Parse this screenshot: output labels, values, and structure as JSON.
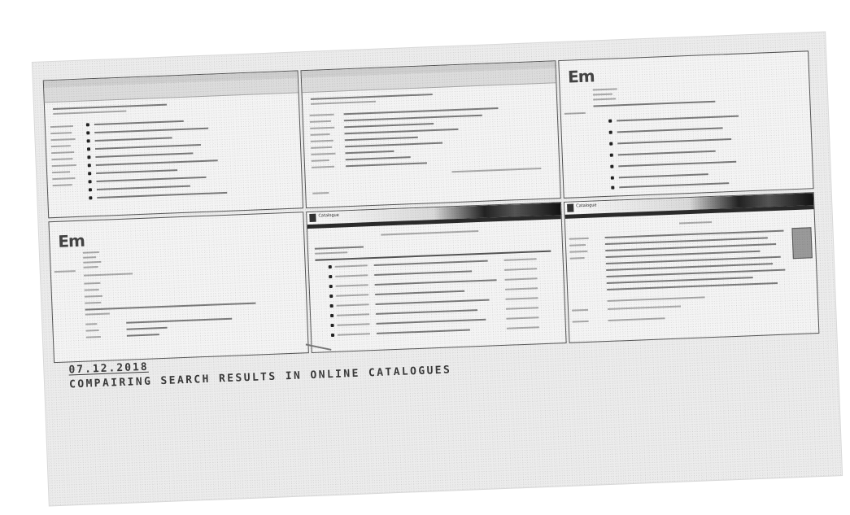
{
  "caption": {
    "date": "07.12.2018",
    "title": "COMPAIRING SEARCH RESULTS IN ONLINE CATALOGUES"
  },
  "panels": {
    "panel3_logo": "Em",
    "panel4_logo": "Em",
    "panel5_header": "Catalogue",
    "panel6_header": "Catalogue"
  },
  "colors": {
    "paper": "#ececec",
    "ink": "#3a3a3a",
    "panel_border": "#555555"
  }
}
